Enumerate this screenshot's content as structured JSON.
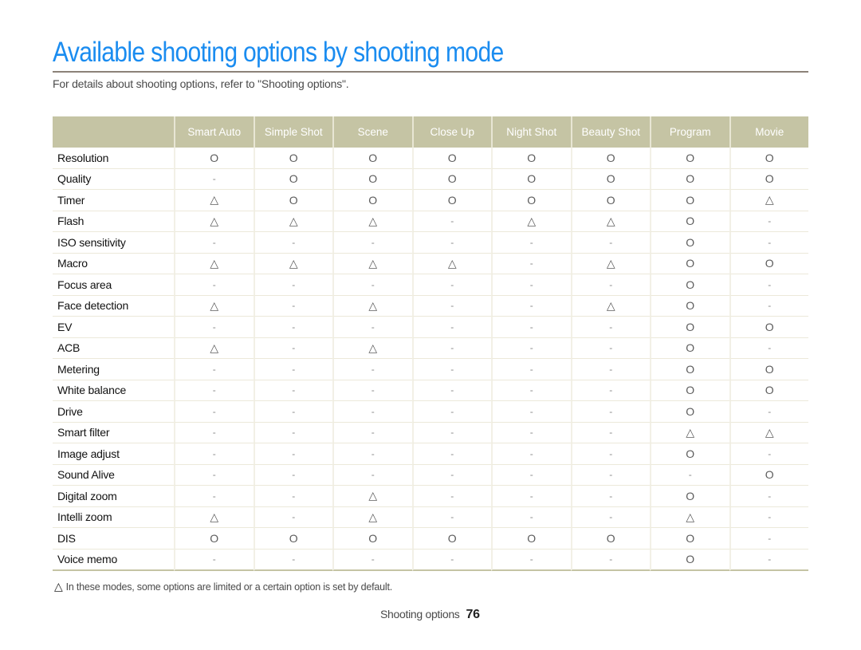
{
  "header": {
    "title": "Available shooting options by shooting mode",
    "subtitle": "For details about shooting options, refer to \"Shooting options\"."
  },
  "table": {
    "columns": [
      "",
      "Smart Auto",
      "Simple Shot",
      "Scene",
      "Close Up",
      "Night Shot",
      "Beauty Shot",
      "Program",
      "Movie"
    ],
    "symbols": {
      "available": "O",
      "limited": "△",
      "unavailable": "-"
    },
    "rows": [
      {
        "label": "Resolution",
        "cells": [
          "O",
          "O",
          "O",
          "O",
          "O",
          "O",
          "O",
          "O"
        ]
      },
      {
        "label": "Quality",
        "cells": [
          "-",
          "O",
          "O",
          "O",
          "O",
          "O",
          "O",
          "O"
        ]
      },
      {
        "label": "Timer",
        "cells": [
          "△",
          "O",
          "O",
          "O",
          "O",
          "O",
          "O",
          "△"
        ]
      },
      {
        "label": "Flash",
        "cells": [
          "△",
          "△",
          "△",
          "-",
          "△",
          "△",
          "O",
          "-"
        ]
      },
      {
        "label": "ISO sensitivity",
        "cells": [
          "-",
          "-",
          "-",
          "-",
          "-",
          "-",
          "O",
          "-"
        ]
      },
      {
        "label": "Macro",
        "cells": [
          "△",
          "△",
          "△",
          "△",
          "-",
          "△",
          "O",
          "O"
        ]
      },
      {
        "label": "Focus area",
        "cells": [
          "-",
          "-",
          "-",
          "-",
          "-",
          "-",
          "O",
          "-"
        ]
      },
      {
        "label": "Face detection",
        "cells": [
          "△",
          "-",
          "△",
          "-",
          "-",
          "△",
          "O",
          "-"
        ]
      },
      {
        "label": "EV",
        "cells": [
          "-",
          "-",
          "-",
          "-",
          "-",
          "-",
          "O",
          "O"
        ]
      },
      {
        "label": "ACB",
        "cells": [
          "△",
          "-",
          "△",
          "-",
          "-",
          "-",
          "O",
          "-"
        ]
      },
      {
        "label": "Metering",
        "cells": [
          "-",
          "-",
          "-",
          "-",
          "-",
          "-",
          "O",
          "O"
        ]
      },
      {
        "label": "White balance",
        "cells": [
          "-",
          "-",
          "-",
          "-",
          "-",
          "-",
          "O",
          "O"
        ]
      },
      {
        "label": "Drive",
        "cells": [
          "-",
          "-",
          "-",
          "-",
          "-",
          "-",
          "O",
          "-"
        ]
      },
      {
        "label": "Smart filter",
        "cells": [
          "-",
          "-",
          "-",
          "-",
          "-",
          "-",
          "△",
          "△"
        ]
      },
      {
        "label": "Image adjust",
        "cells": [
          "-",
          "-",
          "-",
          "-",
          "-",
          "-",
          "O",
          "-"
        ]
      },
      {
        "label": "Sound Alive",
        "cells": [
          "-",
          "-",
          "-",
          "-",
          "-",
          "-",
          "-",
          "O"
        ]
      },
      {
        "label": "Digital zoom",
        "cells": [
          "-",
          "-",
          "△",
          "-",
          "-",
          "-",
          "O",
          "-"
        ]
      },
      {
        "label": "Intelli zoom",
        "cells": [
          "△",
          "-",
          "△",
          "-",
          "-",
          "-",
          "△",
          "-"
        ]
      },
      {
        "label": "DIS",
        "cells": [
          "O",
          "O",
          "O",
          "O",
          "O",
          "O",
          "O",
          "-"
        ]
      },
      {
        "label": "Voice memo",
        "cells": [
          "-",
          "-",
          "-",
          "-",
          "-",
          "-",
          "O",
          "-"
        ]
      }
    ]
  },
  "footnote": {
    "symbol": "△",
    "text": "In these modes, some options are limited or a certain option is set by default."
  },
  "footer": {
    "section": "Shooting options",
    "page_number": "76"
  },
  "colors": {
    "title": "#1a8cf0",
    "header_bg": "#c5c4a4",
    "rule": "#8c8278"
  }
}
